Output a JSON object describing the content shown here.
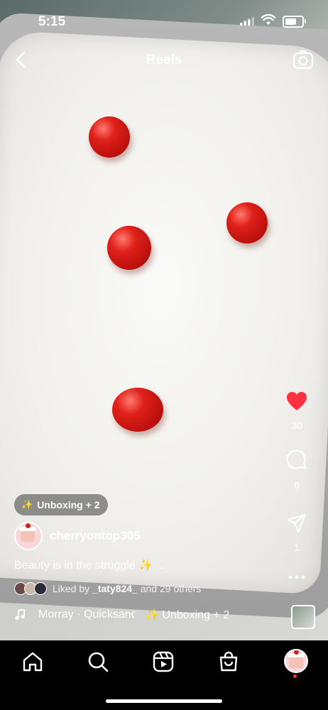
{
  "status_bar": {
    "time": "5:15"
  },
  "header": {
    "title": "Reels"
  },
  "rail": {
    "likes": "30",
    "comments": "6",
    "shares": "1"
  },
  "effect_chip": {
    "label": "Unboxing + 2"
  },
  "post": {
    "username": "cherryontop305",
    "caption": "Beauty is in the struggle ✨ ...",
    "liked_prefix": "Liked by ",
    "liked_user": "_taty824_",
    "liked_suffix": " and 29 others"
  },
  "music": {
    "text": "Morray · Quicksand",
    "effect": "Unboxing + 2"
  },
  "colors": {
    "like_red": "#ff3040",
    "cherry_red": "#d0231c"
  },
  "icons": [
    "back-icon",
    "camera-icon",
    "heart-icon",
    "comment-icon",
    "share-icon",
    "more-icon",
    "music-note-icon",
    "sparkle-icon",
    "home-icon",
    "search-icon",
    "reels-icon",
    "shop-icon"
  ]
}
